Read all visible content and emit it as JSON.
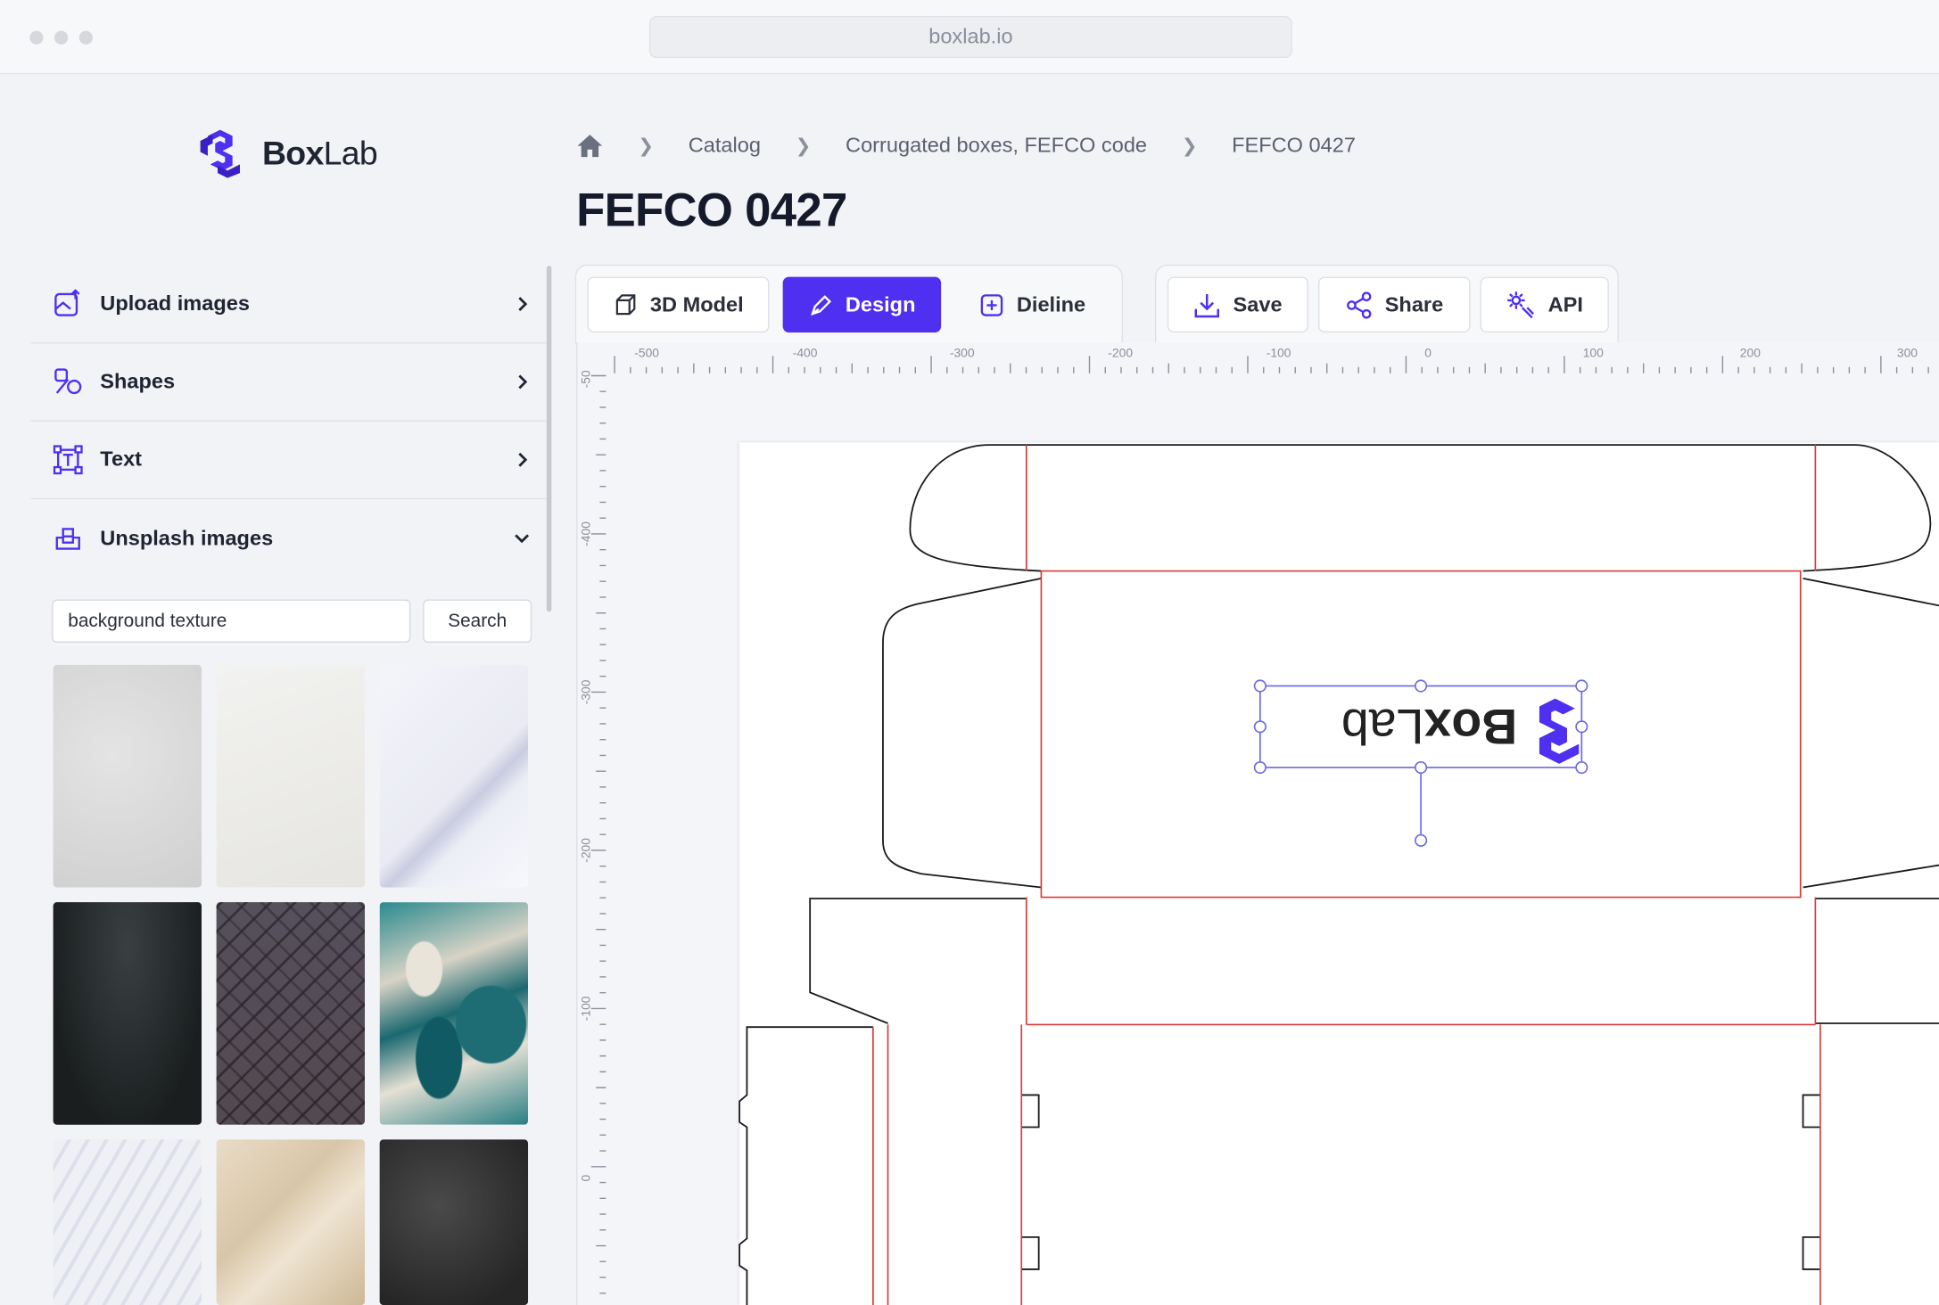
{
  "browser": {
    "url": "boxlab.io"
  },
  "logo": {
    "name_bold": "Box",
    "name_light": "Lab"
  },
  "breadcrumb": {
    "items": [
      "Catalog",
      "Corrugated boxes, FEFCO code",
      "FEFCO 0427"
    ]
  },
  "page": {
    "title": "FEFCO 0427"
  },
  "sidebar": {
    "items": [
      {
        "label": "Upload images",
        "icon": "upload-image-icon",
        "expanded": false
      },
      {
        "label": "Shapes",
        "icon": "shapes-icon",
        "expanded": false
      },
      {
        "label": "Text",
        "icon": "text-icon",
        "expanded": false
      },
      {
        "label": "Unsplash images",
        "icon": "unsplash-icon",
        "expanded": true
      }
    ],
    "search": {
      "value": "background texture",
      "button": "Search"
    },
    "thumbnails": [
      "light gray paper",
      "white paper",
      "white fold",
      "dark gradient",
      "dark tiles",
      "teal marble",
      "white waves",
      "crumpled paper",
      "chalkboard"
    ]
  },
  "tabs": {
    "view": [
      {
        "label": "3D Model",
        "icon": "cube-icon",
        "active": false
      },
      {
        "label": "Design",
        "icon": "pen-icon",
        "active": true
      },
      {
        "label": "Dieline",
        "icon": "dieline-icon",
        "active": false
      }
    ],
    "actions": [
      {
        "label": "Save",
        "icon": "download-icon"
      },
      {
        "label": "Share",
        "icon": "share-icon"
      },
      {
        "label": "API",
        "icon": "wrench-icon"
      }
    ]
  },
  "ruler": {
    "horizontal": [
      "-500",
      "-400",
      "-300",
      "-200",
      "-100",
      "0",
      "100",
      "200",
      "300"
    ],
    "vertical": [
      "-50",
      "-400",
      "-300",
      "-200",
      "-100",
      "0"
    ]
  },
  "design": {
    "logo_text_bold": "Box",
    "logo_text_light": "Lab"
  },
  "colors": {
    "accent": "#4f2ff0",
    "cut_line": "#1a1a1a",
    "fold_line": "#d93a3a",
    "selection": "#6a6ae8"
  }
}
